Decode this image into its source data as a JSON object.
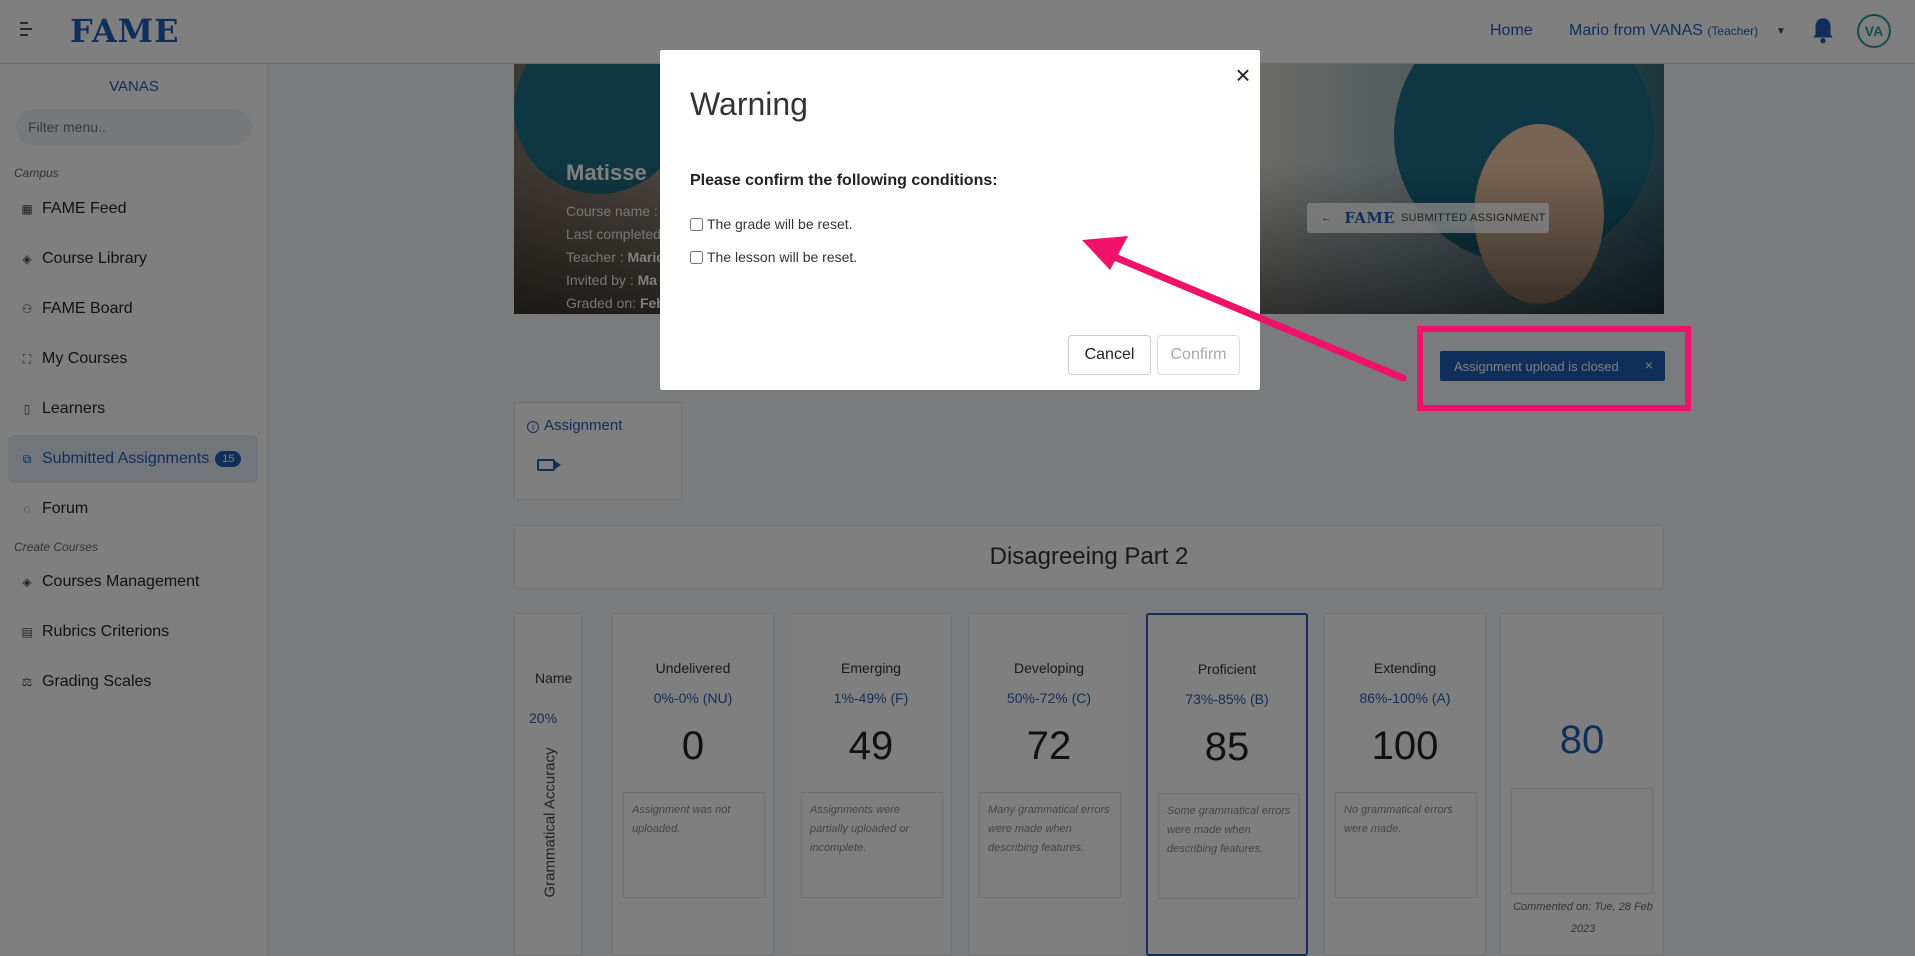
{
  "topbar": {
    "logo": "FAME",
    "home": "Home",
    "user_name": "Mario from VANAS",
    "user_role": "(Teacher)",
    "avatar_initials": "VA"
  },
  "sidebar": {
    "org": "VANAS",
    "filter_placeholder": "Filter menu..",
    "section_campus": "Campus",
    "section_create": "Create Courses",
    "items": [
      {
        "label": "FAME Feed",
        "icon": "grid-icon"
      },
      {
        "label": "Course Library",
        "icon": "layers-icon"
      },
      {
        "label": "FAME Board",
        "icon": "users-icon"
      },
      {
        "label": "My Courses",
        "icon": "expand-icon"
      },
      {
        "label": "Learners",
        "icon": "book-icon"
      },
      {
        "label": "Submitted Assignments",
        "icon": "copy-icon",
        "badge": "15"
      },
      {
        "label": "Forum",
        "icon": "chat-icon"
      },
      {
        "label": "Courses Management",
        "icon": "layers-icon"
      },
      {
        "label": "Rubrics Criterions",
        "icon": "table-icon"
      },
      {
        "label": "Grading Scales",
        "icon": "scale-icon"
      }
    ]
  },
  "hero": {
    "name": "Matisse",
    "line1_label": "Course name :",
    "line2_label": "Last completed",
    "line3_label": "Teacher :",
    "line3_value": "Mario",
    "line4_label": "Invited by :",
    "line4_value": "Ma",
    "line5_label": "Graded on:",
    "line5_value": "Feb",
    "submitted_logo": "FAME",
    "submitted_label": "SUBMITTED ASSIGNMENT"
  },
  "toast": {
    "text": "Assignment upload is closed",
    "close": "×"
  },
  "assignment_tab": "Assignment",
  "lesson_title": "Disagreeing Part 2",
  "rubric": {
    "name_header": "Name",
    "weight": "20%",
    "criterion": "Grammatical Accuracy",
    "levels": [
      {
        "title": "Undelivered",
        "range": "0%-0% (NU)",
        "value": "0",
        "desc": "Assignment was not uploaded."
      },
      {
        "title": "Emerging",
        "range": "1%-49% (F)",
        "value": "49",
        "desc": "Assignments were partially uploaded or incomplete."
      },
      {
        "title": "Developing",
        "range": "50%-72% (C)",
        "value": "72",
        "desc": "Many grammatical errors were made when describing features."
      },
      {
        "title": "Proficient",
        "range": "73%-85% (B)",
        "value": "85",
        "desc": "Some grammatical errors were made when describing features."
      },
      {
        "title": "Extending",
        "range": "86%-100% (A)",
        "value": "100",
        "desc": "No grammatical errors were made."
      }
    ],
    "score": "80",
    "commented": "Commented on: Tue, 28 Feb 2023"
  },
  "modal": {
    "title": "Warning",
    "close": "×",
    "subtitle": "Please confirm the following conditions:",
    "conditions": [
      "The grade will be reset.",
      "The lesson will be reset."
    ],
    "cancel": "Cancel",
    "confirm": "Confirm"
  },
  "colors": {
    "brand": "#1f5fb5",
    "highlight": "#f0116a"
  }
}
